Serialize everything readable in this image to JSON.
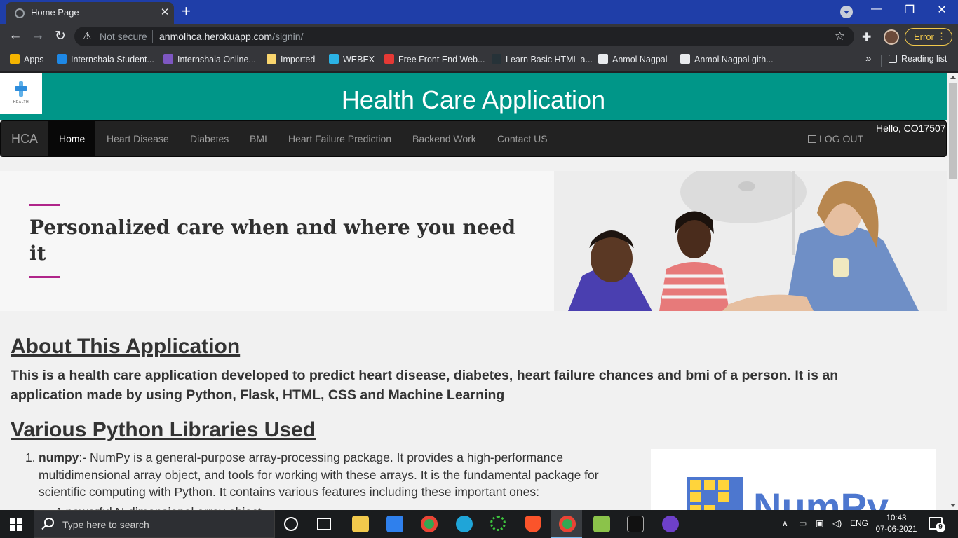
{
  "browser": {
    "tab_title": "Home Page",
    "tab_close": "✕",
    "new_tab": "+",
    "window_controls": {
      "minimize": "—",
      "restore": "❐",
      "close": "✕"
    },
    "nav": {
      "back": "←",
      "forward": "→",
      "reload": "↻"
    },
    "security_label": "Not secure",
    "url_host": "anmolhca.herokuapp.com",
    "url_path": "/signin/",
    "bookmark_star": "☆",
    "extensions_icon": "✚",
    "error_label": "Error",
    "menu_dots": "⋮"
  },
  "bookmarks": {
    "items": [
      {
        "label": "Apps",
        "icon_color": "#f4b400"
      },
      {
        "label": "Internshala Student...",
        "icon_color": "#1e88e5"
      },
      {
        "label": "Internshala Online...",
        "icon_color": "#7e57c2"
      },
      {
        "label": "Imported",
        "icon_color": "#f9d56e"
      },
      {
        "label": "WEBEX",
        "icon_color": "#2bb3e6"
      },
      {
        "label": "Free Front End Web...",
        "icon_color": "#e53935"
      },
      {
        "label": "Learn Basic HTML a...",
        "icon_color": "#263238"
      },
      {
        "label": "Anmol Nagpal",
        "icon_color": "#e8eaed"
      },
      {
        "label": "Anmol Nagpal gith...",
        "icon_color": "#e8eaed"
      }
    ],
    "more": "»",
    "reading_list": "Reading list"
  },
  "site": {
    "logo_text": "HEALTH",
    "title": "Health Care Application",
    "brand": "HCA",
    "nav": [
      "Home",
      "Heart Disease",
      "Diabetes",
      "BMI",
      "Heart Failure Prediction",
      "Backend Work",
      "Contact US"
    ],
    "active_nav": "Home",
    "logout": "LOG OUT",
    "greeting": "Hello, CO17507",
    "accent_color": "#009688",
    "banner_tagline": "Personalized care when and where you need it",
    "about_heading": "About This Application",
    "about_text": "This is a health care application developed to predict heart disease, diabetes, heart failure chances and bmi of a person. It is an application made by using Python, Flask, HTML, CSS and Machine Learning",
    "libs_heading": "Various Python Libraries Used",
    "libs": [
      {
        "number": "1.",
        "name": "numpy",
        "separator": ":-",
        "description": " NumPy is a general-purpose array-processing package. It provides a high-performance multidimensional array object, and tools for working with these arrays. It is the fundamental package for scientific computing with Python. It contains various features including these important ones:",
        "sub_item": "A powerful N-dimensional array object"
      }
    ],
    "numpy_logo_text": "NumPy"
  },
  "taskbar": {
    "search_placeholder": "Type here to search",
    "language": "ENG",
    "time": "10:43",
    "date": "07-06-2021",
    "notification_count": "9"
  }
}
